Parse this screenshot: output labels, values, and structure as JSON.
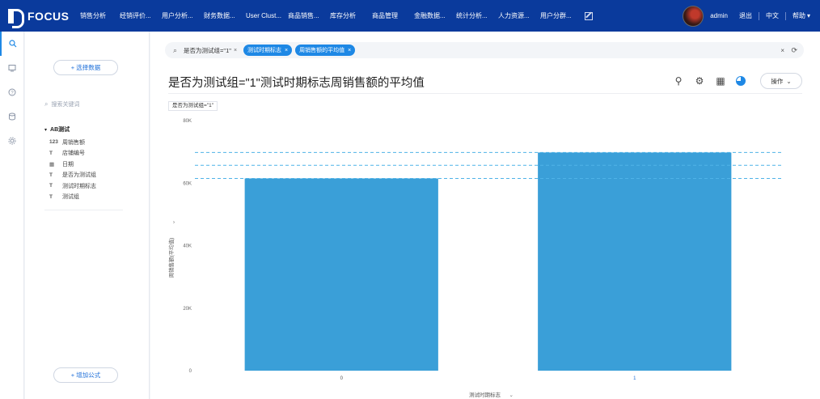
{
  "brand": {
    "name": "FOCUS"
  },
  "nav": {
    "items": [
      "销售分析",
      "经销评价...",
      "用户分析...",
      "财务数据...",
      "User Clust...",
      "商品销售...",
      "库存分析",
      "商品管理",
      "金融数据...",
      "统计分析...",
      "人力资源...",
      "用户分群..."
    ],
    "edit_icon": "edit-icon"
  },
  "user": {
    "name": "admin",
    "logout": "退出",
    "language": "中文",
    "help": "帮助",
    "help_caret": "▾"
  },
  "rail": [
    "search-icon",
    "dashboard-icon",
    "help-icon",
    "database-icon",
    "settings-icon"
  ],
  "panel": {
    "select_data": "+ 选择数据",
    "search_placeholder": "搜索关键词",
    "tree_root": "AB测试",
    "fields": [
      {
        "type": "123",
        "name": "周销售额"
      },
      {
        "type": "T",
        "name": "店铺编号"
      },
      {
        "type": "▦",
        "name": "日期"
      },
      {
        "type": "T",
        "name": "是否为测试组"
      },
      {
        "type": "T",
        "name": "测试时期标志"
      },
      {
        "type": "T",
        "name": "测试组"
      }
    ],
    "add_formula": "+ 增加公式"
  },
  "query": {
    "text": "是否为测试组=\"1\"",
    "text_close": "×",
    "tokens": [
      "测试时期标志",
      "周销售额的平均值"
    ],
    "token_close": "×",
    "clear": "×",
    "refresh": "⟳"
  },
  "header": {
    "title": "是否为测试组=\"1\"测试时期标志周销售额的平均值",
    "operate": "操作",
    "operate_caret": "⌄",
    "filter_chip": "是否为测试组=\"1\"",
    "pin_glyph": "⚲",
    "settings_glyph": "⚙",
    "table_glyph": "▦"
  },
  "chart_data": {
    "type": "bar",
    "categories": [
      "0",
      "1"
    ],
    "values": [
      61500,
      69800
    ],
    "xlabel": "测试时期标志",
    "xlabel_caret": "⌄",
    "ylabel": "周销售额(平均值)",
    "ylabel_caret": "›",
    "yticks": [
      "0",
      "20K",
      "40K",
      "60K",
      "80K"
    ],
    "ylim": [
      0,
      80000
    ],
    "reference_lines": [
      61500,
      65700,
      69800
    ],
    "bar_color": "#3a9fd8",
    "reference_color": "#4fb3e8"
  }
}
